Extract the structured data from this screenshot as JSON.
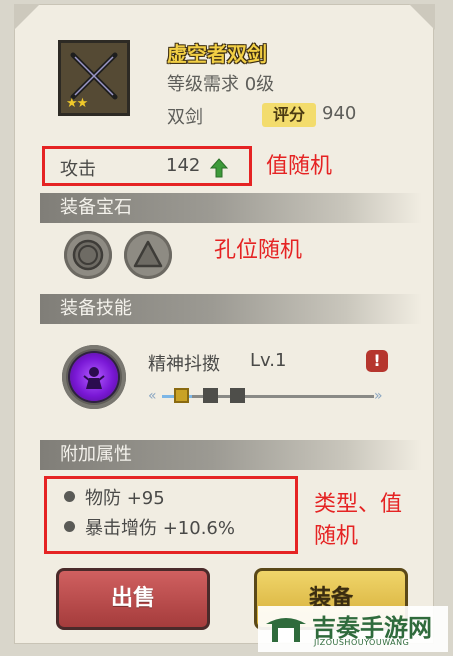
{
  "item": {
    "name": "虚空者双剑",
    "level_req": "等级需求 0级",
    "type": "双剑",
    "score_label": "评分",
    "score_value": "940",
    "stars": "★★",
    "icon": "crossed-swords-icon"
  },
  "attack": {
    "label": "攻击",
    "value": "142",
    "arrow_icon": "arrow-up-icon"
  },
  "annotations": {
    "value_random": "值随机",
    "socket_random": "孔位随机",
    "type_value_random_line1": "类型、值",
    "type_value_random_line2": "随机"
  },
  "sections": {
    "gems": "装备宝石",
    "skills": "装备技能",
    "attributes": "附加属性"
  },
  "gem_sockets": [
    {
      "shape": "circle-icon"
    },
    {
      "shape": "triangle-icon"
    }
  ],
  "skill": {
    "name": "精神抖擞",
    "level": "Lv.1",
    "progress_level": 1,
    "progress_max": 3
  },
  "attributes": [
    {
      "text": "物防 +95"
    },
    {
      "text": "暴击增伤 +10.6%"
    }
  ],
  "buttons": {
    "sell": "出售",
    "equip": "装备"
  },
  "watermark": {
    "title": "吉奏手游网",
    "sub": "JIZOUSHOUYOUWANG"
  },
  "colors": {
    "accent_red": "#e52323",
    "title_gold": "#f2cf45",
    "skill_purple": "#7a18d6"
  }
}
